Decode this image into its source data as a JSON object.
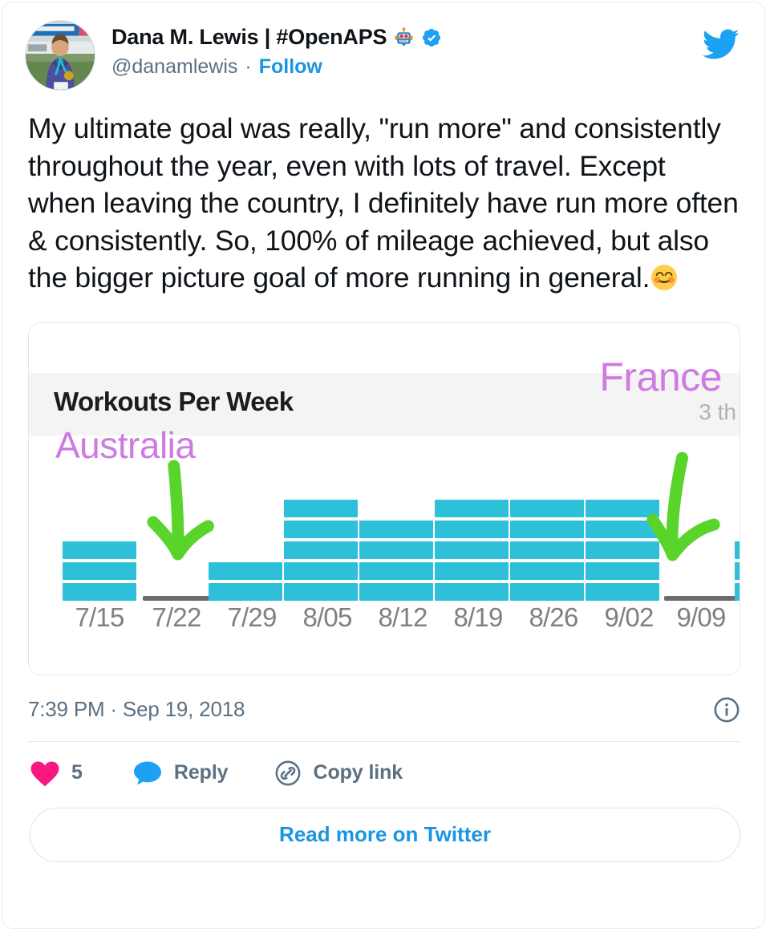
{
  "tweet": {
    "display_name": "Dana M. Lewis | #OpenAPS",
    "name_emoji": "robot-face",
    "verified": true,
    "handle": "@danamlewis",
    "separator": "·",
    "follow_label": "Follow",
    "text": "My ultimate goal was really, \"run more\" and consistently throughout the year, even with lots of travel. Except when leaving the country, I definitely have run more often & consistently. So, 100% of mileage achieved, but also the bigger picture goal of more running in general.",
    "text_emoji": "smiling-face-with-smiling-eyes",
    "timestamp": "7:39 PM · Sep 19, 2018",
    "like_count": "5",
    "reply_label": "Reply",
    "copy_link_label": "Copy link",
    "read_more_label": "Read more on Twitter"
  },
  "colors": {
    "twitter_blue": "#1b95e0",
    "bird_blue": "#1da1f2",
    "like_pink": "#f91880",
    "reply_blue": "#1da1f2",
    "bar_cyan": "#2dc0d8",
    "annotation_purple": "#cf7ae0",
    "arrow_green": "#58d42a",
    "meta_gray": "#5b7083"
  },
  "chart_data": {
    "type": "bar",
    "title": "Workouts Per Week",
    "xlabel": "",
    "ylabel": "",
    "categories": [
      "7/15",
      "7/22",
      "7/29",
      "8/05",
      "8/12",
      "8/19",
      "8/26",
      "9/02",
      "9/09",
      ""
    ],
    "values": [
      3,
      0,
      2,
      5,
      4,
      5,
      5,
      5,
      0,
      3
    ],
    "ylim": [
      0,
      5
    ],
    "grid": false,
    "legend": "none",
    "stacked_segments": true,
    "note": "each bar is drawn as stacked unit segments; weeks with 0 workouts show a gray baseline marker",
    "annotations": [
      {
        "text": "Australia",
        "color": "#cf7ae0",
        "points_to": "7/22"
      },
      {
        "text": "France",
        "color": "#cf7ae0",
        "points_to": "9/09"
      },
      {
        "text": "3 th",
        "color": "#b3b3b3",
        "clipped": true
      }
    ]
  }
}
